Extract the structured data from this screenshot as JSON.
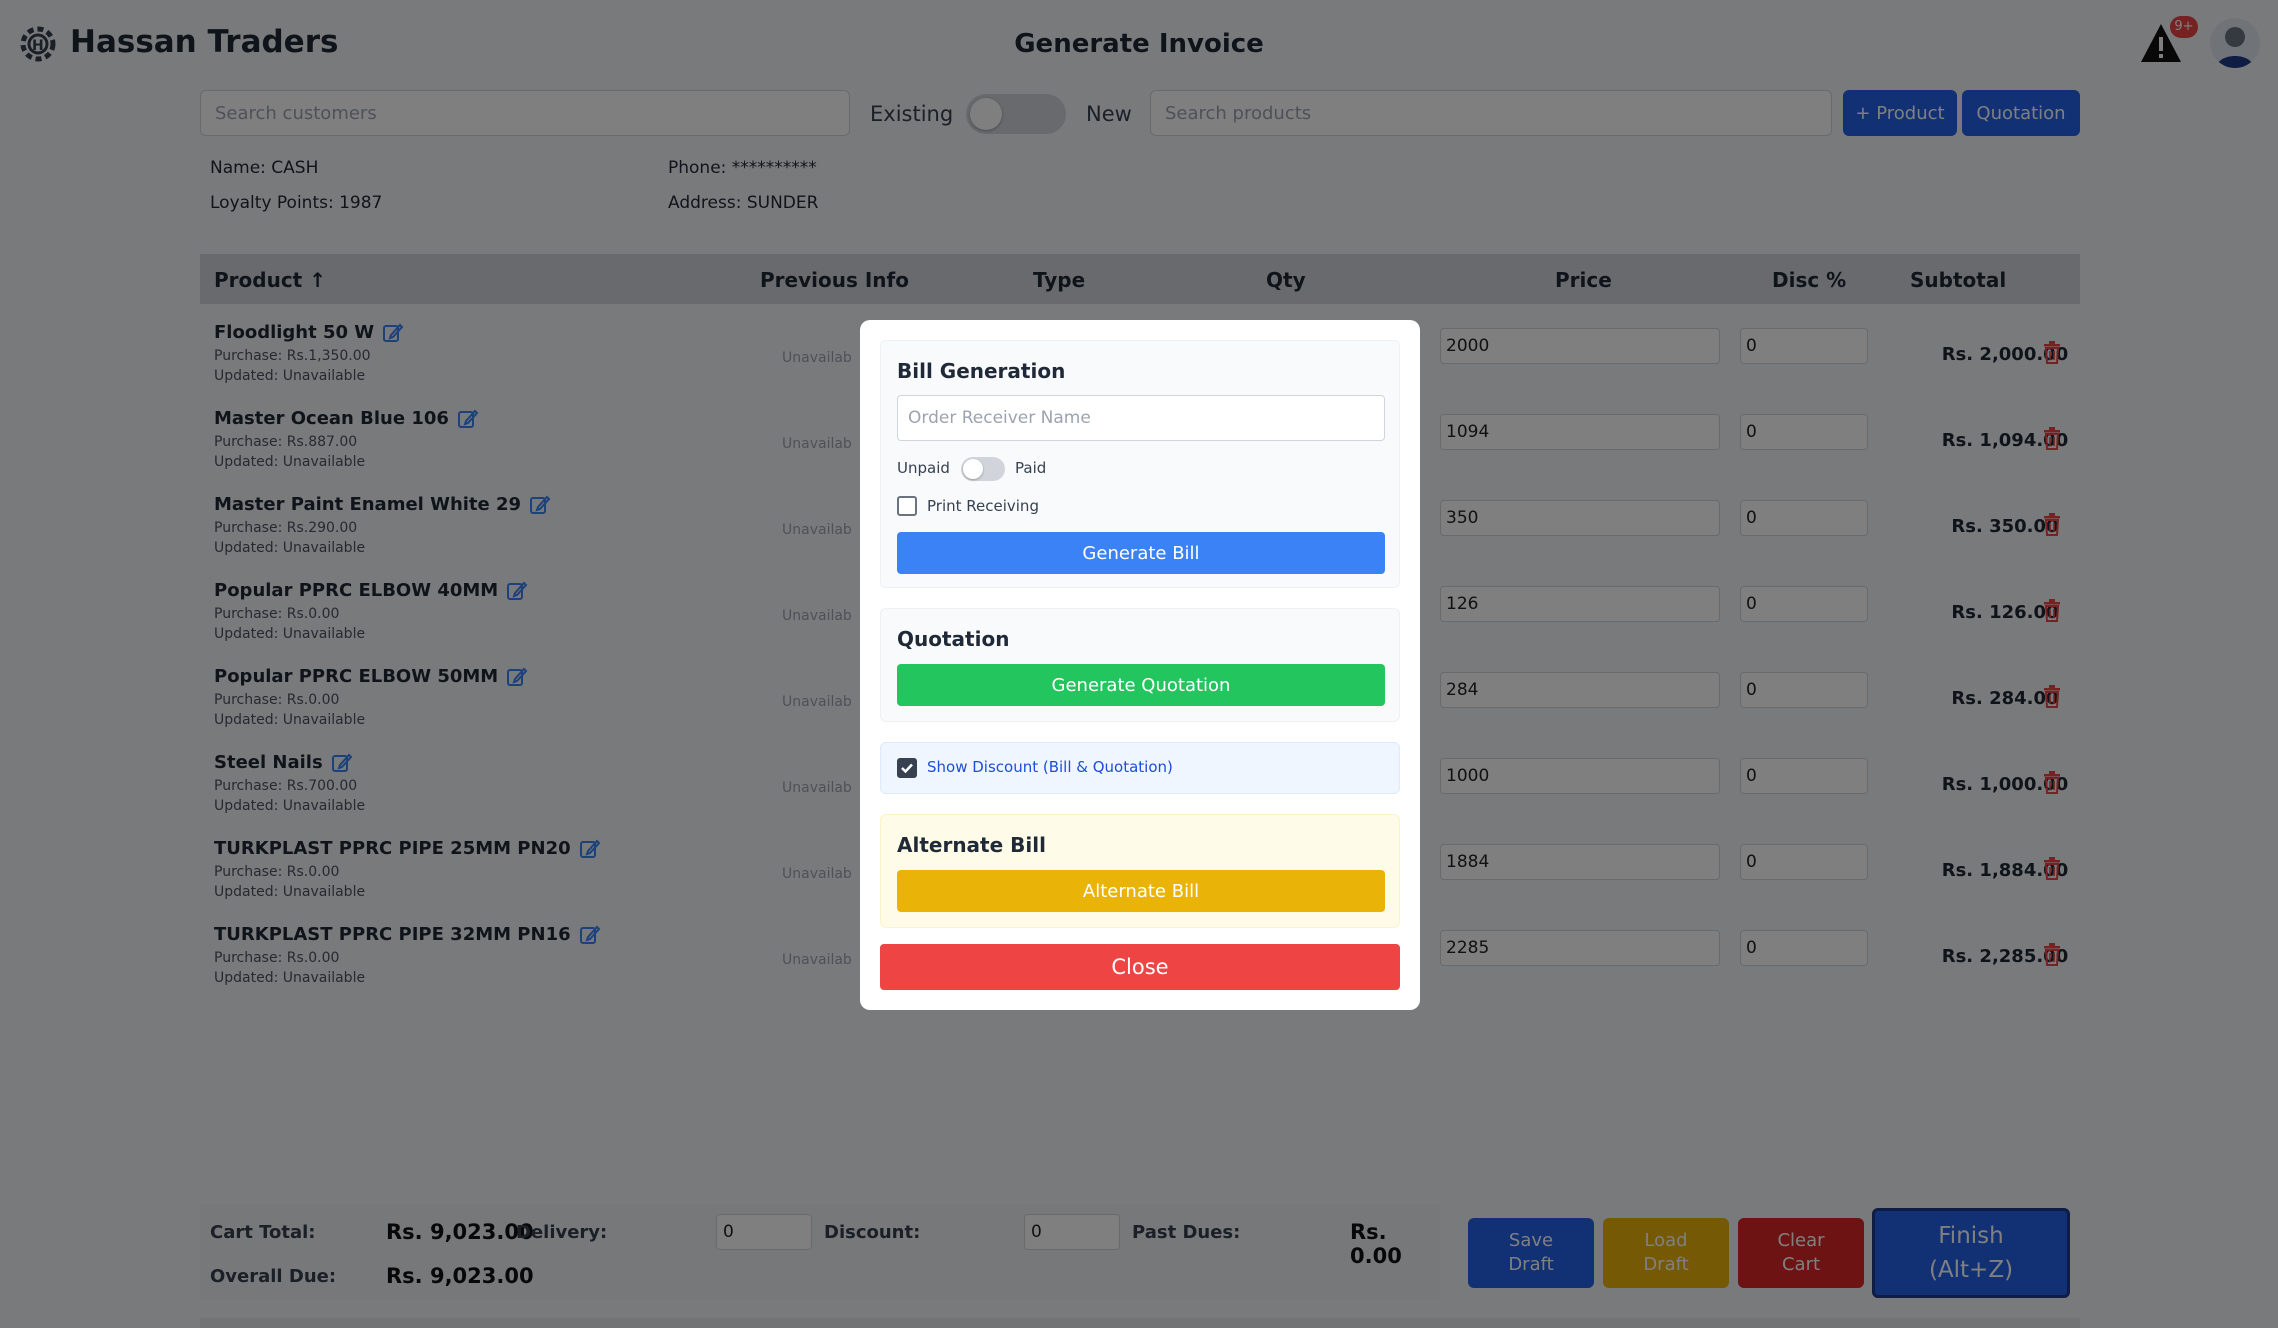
{
  "header": {
    "brand": "Hassan Traders",
    "title": "Generate Invoice",
    "alert_badge": "9+"
  },
  "topbar": {
    "customer_search_placeholder": "Search customers",
    "toggle_left": "Existing",
    "toggle_right": "New",
    "product_search_placeholder": "Search products",
    "add_product_label": "+ Product",
    "quotation_label": "Quotation"
  },
  "customer": {
    "name": "Name: CASH",
    "phone": "Phone: **********",
    "loyalty": "Loyalty Points: 1987",
    "address": "Address: SUNDER"
  },
  "table": {
    "headers": {
      "product": "Product ↑",
      "previous_info": "Previous Info",
      "type": "Type",
      "qty": "Qty",
      "price": "Price",
      "disc": "Disc %",
      "subtotal": "Subtotal"
    },
    "rows": [
      {
        "name": "Floodlight 50 W",
        "purchase": "Purchase: Rs.1,350.00",
        "updated": "Updated: Unavailable",
        "prev": "Unavailab",
        "price": "2000",
        "disc": "0",
        "subtotal": "Rs. 2,000.00"
      },
      {
        "name": "Master Ocean Blue 106",
        "purchase": "Purchase: Rs.887.00",
        "updated": "Updated: Unavailable",
        "prev": "Unavailab",
        "price": "1094",
        "disc": "0",
        "subtotal": "Rs. 1,094.00"
      },
      {
        "name": "Master Paint Enamel White 29",
        "purchase": "Purchase: Rs.290.00",
        "updated": "Updated: Unavailable",
        "prev": "Unavailab",
        "price": "350",
        "disc": "0",
        "subtotal": "Rs. 350.00"
      },
      {
        "name": "Popular PPRC ELBOW 40MM",
        "purchase": "Purchase: Rs.0.00",
        "updated": "Updated: Unavailable",
        "prev": "Unavailab",
        "price": "126",
        "disc": "0",
        "subtotal": "Rs. 126.00"
      },
      {
        "name": "Popular PPRC ELBOW 50MM",
        "purchase": "Purchase: Rs.0.00",
        "updated": "Updated: Unavailable",
        "prev": "Unavailab",
        "price": "284",
        "disc": "0",
        "subtotal": "Rs. 284.00"
      },
      {
        "name": "Steel Nails",
        "purchase": "Purchase: Rs.700.00",
        "updated": "Updated: Unavailable",
        "prev": "Unavailab",
        "price": "1000",
        "disc": "0",
        "subtotal": "Rs. 1,000.00"
      },
      {
        "name": "TURKPLAST PPRC PIPE 25MM PN20",
        "purchase": "Purchase: Rs.0.00",
        "updated": "Updated: Unavailable",
        "prev": "Unavailab",
        "price": "1884",
        "disc": "0",
        "subtotal": "Rs. 1,884.00"
      },
      {
        "name": "TURKPLAST PPRC PIPE 32MM PN16",
        "purchase": "Purchase: Rs.0.00",
        "updated": "Updated: Unavailable",
        "prev": "Unavailab",
        "price": "2285",
        "disc": "0",
        "subtotal": "Rs. 2,285.00"
      }
    ]
  },
  "footer": {
    "cart_total_label": "Cart Total:",
    "cart_total_value": "Rs. 9,023.00",
    "delivery_label": "Delivery:",
    "delivery_value": "0",
    "discount_label": "Discount:",
    "discount_value": "0",
    "past_dues_label": "Past Dues:",
    "past_dues_value": "Rs. 0.00",
    "overall_due_label": "Overall Due:",
    "overall_due_value": "Rs. 9,023.00",
    "save_draft": [
      "Save",
      "Draft"
    ],
    "load_draft": [
      "Load",
      "Draft"
    ],
    "clear_cart": [
      "Clear",
      "Cart"
    ],
    "finish": [
      "Finish",
      "(Alt+Z)"
    ]
  },
  "modal": {
    "bill_title": "Bill Generation",
    "receiver_placeholder": "Order Receiver Name",
    "unpaid": "Unpaid",
    "paid": "Paid",
    "print_receiving": "Print Receiving",
    "generate_bill": "Generate Bill",
    "quotation_title": "Quotation",
    "generate_quotation": "Generate Quotation",
    "show_discount": "Show Discount (Bill & Quotation)",
    "alternate_title": "Alternate Bill",
    "alternate_button": "Alternate Bill",
    "close": "Close"
  },
  "colors": {
    "primary": "#2563eb",
    "success": "#22c55e",
    "warning": "#eab308",
    "danger": "#ef4444",
    "dark_blue": "#1e3a8a"
  }
}
